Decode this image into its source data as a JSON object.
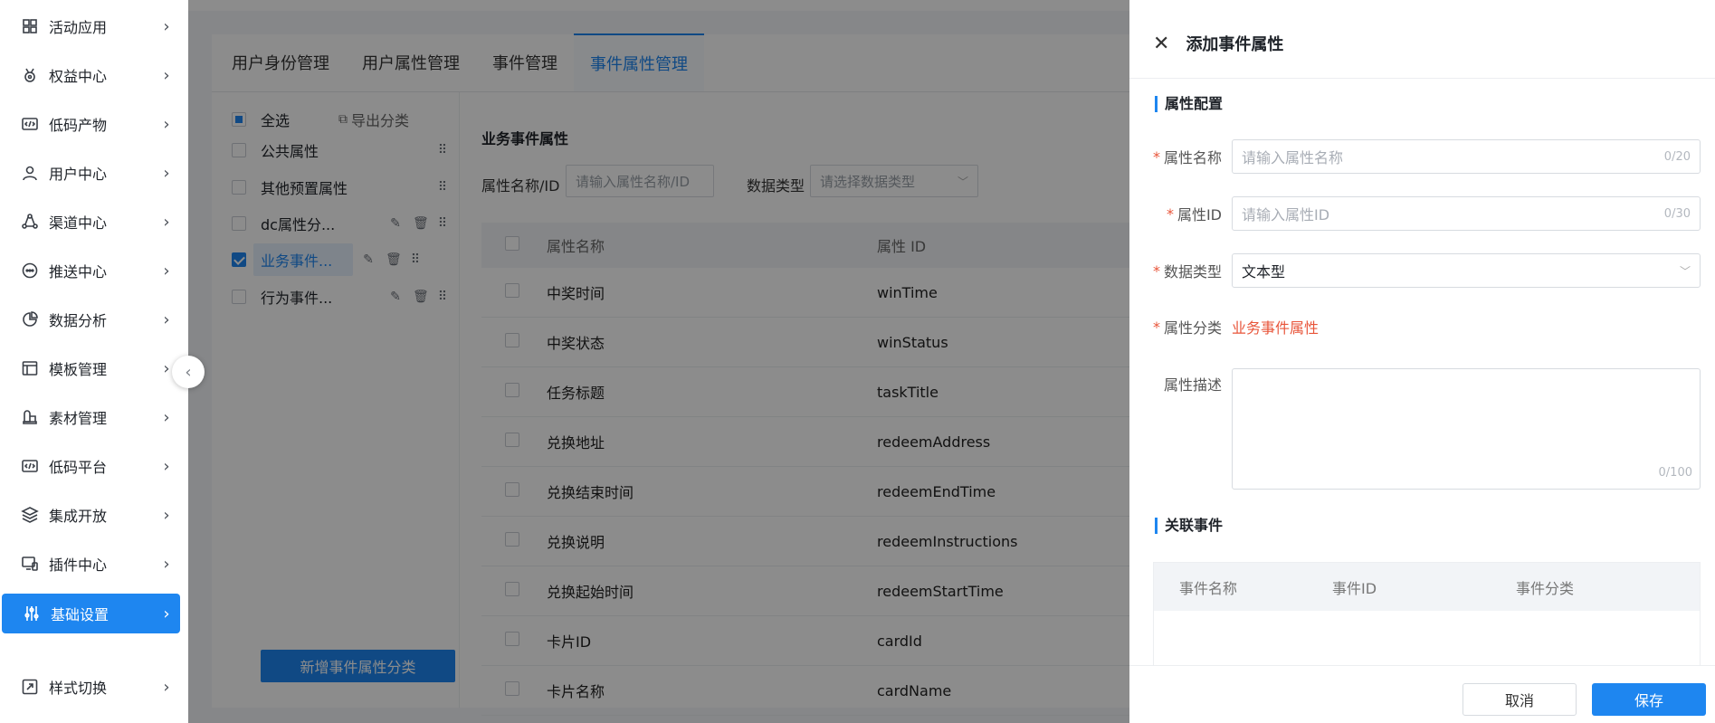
{
  "sidebar": {
    "items": [
      {
        "label": "活动应用",
        "icon": "grid-icon"
      },
      {
        "label": "权益中心",
        "icon": "medal-icon"
      },
      {
        "label": "低码产物",
        "icon": "code-box-icon"
      },
      {
        "label": "用户中心",
        "icon": "user-icon"
      },
      {
        "label": "渠道中心",
        "icon": "channel-icon"
      },
      {
        "label": "推送中心",
        "icon": "chat-icon"
      },
      {
        "label": "数据分析",
        "icon": "pie-icon"
      },
      {
        "label": "模板管理",
        "icon": "layout-icon"
      },
      {
        "label": "素材管理",
        "icon": "material-icon"
      },
      {
        "label": "低码平台",
        "icon": "code-platform-icon"
      },
      {
        "label": "集成开放",
        "icon": "layers-icon"
      },
      {
        "label": "插件中心",
        "icon": "plugin-icon"
      },
      {
        "label": "基础设置",
        "icon": "settings-sliders-icon",
        "active": true
      },
      {
        "label": "样式切换",
        "icon": "style-switch-icon"
      }
    ],
    "chevron": "›",
    "collapse_glyph": "‹"
  },
  "tabs": [
    "用户身份管理",
    "用户属性管理",
    "事件管理",
    "事件属性管理"
  ],
  "tree": {
    "select_all": "全选",
    "export": "导出分类",
    "items": [
      "公共属性",
      "其他预置属性",
      "dc属性分...",
      "业务事件...",
      "行为事件..."
    ],
    "add_button": "新增事件属性分类"
  },
  "content": {
    "section_title": "业务事件属性",
    "filter_name_label": "属性名称/ID",
    "filter_name_placeholder": "请输入属性名称/ID",
    "filter_type_label": "数据类型",
    "filter_type_placeholder": "请选择数据类型",
    "table": {
      "headers": [
        "属性名称",
        "属性 ID"
      ],
      "rows": [
        [
          "中奖时间",
          "winTime"
        ],
        [
          "中奖状态",
          "winStatus"
        ],
        [
          "任务标题",
          "taskTitle"
        ],
        [
          "兑换地址",
          "redeemAddress"
        ],
        [
          "兑换结束时间",
          "redeemEndTime"
        ],
        [
          "兑换说明",
          "redeemInstructions"
        ],
        [
          "兑换起始时间",
          "redeemStartTime"
        ],
        [
          "卡片ID",
          "cardId"
        ],
        [
          "卡片名称",
          "cardName"
        ]
      ]
    }
  },
  "drawer": {
    "title": "添加事件属性",
    "group_config": "属性配置",
    "name_label": "属性名称",
    "name_placeholder": "请输入属性名称",
    "name_count": "0/20",
    "id_label": "属性ID",
    "id_placeholder": "请输入属性ID",
    "id_count": "0/30",
    "type_label": "数据类型",
    "type_value": "文本型",
    "category_label": "属性分类",
    "category_value": "业务事件属性",
    "desc_label": "属性描述",
    "desc_count": "0/100",
    "group_events": "关联事件",
    "event_headers": [
      "事件名称",
      "事件ID",
      "事件分类"
    ],
    "cancel": "取消",
    "save": "保存",
    "required_mark": "*"
  }
}
